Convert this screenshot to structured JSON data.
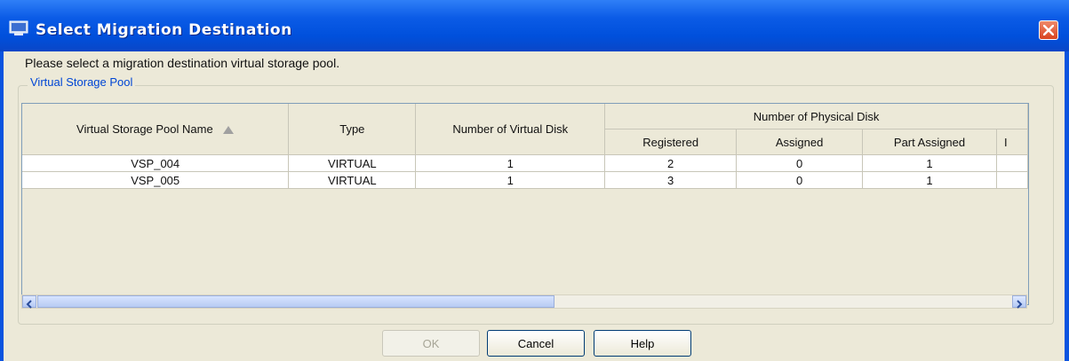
{
  "window": {
    "title": "Select Migration Destination",
    "accent": "#0a54df"
  },
  "prompt": "Please select a migration destination virtual storage pool.",
  "group": {
    "label": "Virtual Storage Pool"
  },
  "table": {
    "headers": {
      "name": "Virtual Storage Pool Name",
      "type": "Type",
      "vdisk": "Number of Virtual Disk",
      "pdisk_group": "Number of Physical Disk",
      "registered": "Registered",
      "assigned": "Assigned",
      "part_assigned": "Part Assigned",
      "truncated": "I"
    },
    "rows": [
      {
        "name": "VSP_004",
        "type": "VIRTUAL",
        "vdisk": "1",
        "registered": "2",
        "assigned": "0",
        "part_assigned": "1"
      },
      {
        "name": "VSP_005",
        "type": "VIRTUAL",
        "vdisk": "1",
        "registered": "3",
        "assigned": "0",
        "part_assigned": "1"
      }
    ]
  },
  "buttons": {
    "ok": "OK",
    "cancel": "Cancel",
    "help": "Help"
  },
  "icons": {
    "title": "app-window-icon",
    "close": "close-icon",
    "scroll_left": "scroll-left-icon",
    "scroll_right": "scroll-right-icon"
  }
}
